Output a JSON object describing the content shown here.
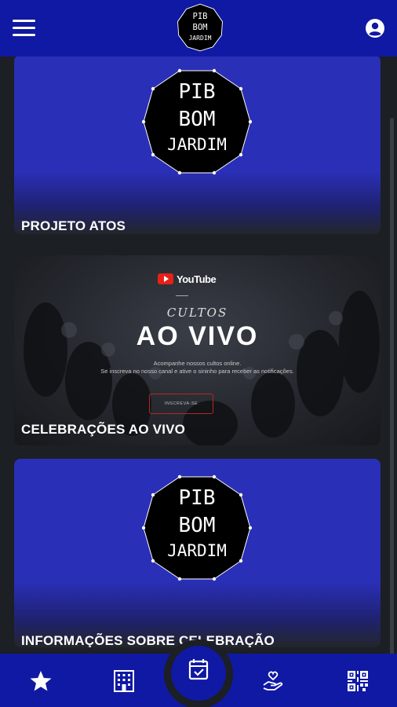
{
  "header": {
    "logo_text": [
      "PIB",
      "BOM",
      "JARDIM"
    ]
  },
  "cards": [
    {
      "title": "PROJETO ATOS"
    },
    {
      "title": "CELEBRAÇÕES AO VIVO",
      "banner": {
        "youtube": "YouTube",
        "cultos": "CULTOS",
        "ao_vivo": "AO VIVO",
        "desc_line1": "Acompanhe nossos cultos online.",
        "desc_line2": "Se inscreva no nosso canal e ative o sininho para receber as notificações.",
        "button": "INSCREVA-SE"
      }
    },
    {
      "title": "INFORMAÇÕES SOBRE CELEBRAÇÃO"
    }
  ],
  "colors": {
    "primary": "#1019a3",
    "banner_blue": "#2a2fb8",
    "background": "#1c1f23"
  },
  "bottom_nav": [
    {
      "icon": "star-icon"
    },
    {
      "icon": "building-icon"
    },
    {
      "icon": "calendar-check-icon",
      "active": true
    },
    {
      "icon": "hand-heart-icon"
    },
    {
      "icon": "qr-code-icon"
    }
  ]
}
